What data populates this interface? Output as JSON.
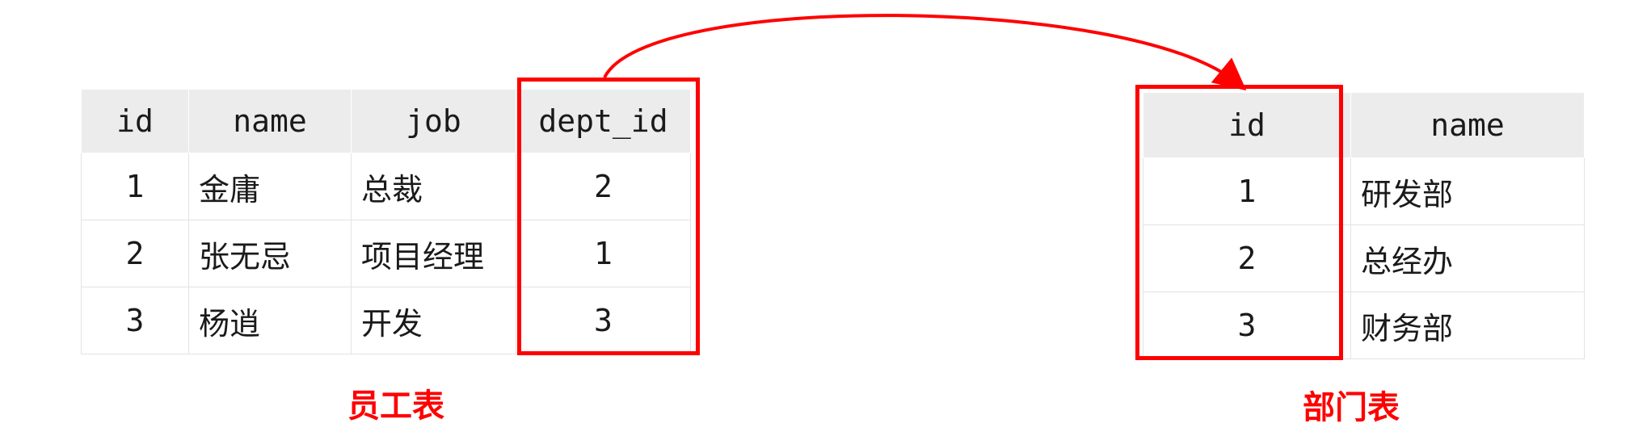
{
  "employee_table": {
    "headers": [
      "id",
      "name",
      "job",
      "dept_id"
    ],
    "rows": [
      [
        "1",
        "金庸",
        "总裁",
        "2"
      ],
      [
        "2",
        "张无忌",
        "项目经理",
        "1"
      ],
      [
        "3",
        "杨逍",
        "开发",
        "3"
      ]
    ],
    "caption": "员工表"
  },
  "department_table": {
    "headers": [
      "id",
      "name"
    ],
    "rows": [
      [
        "1",
        "研发部"
      ],
      [
        "2",
        "总经办"
      ],
      [
        "3",
        "财务部"
      ]
    ],
    "caption": "部门表"
  },
  "colors": {
    "highlight": "#ff0000",
    "header_bg": "#ececec"
  }
}
